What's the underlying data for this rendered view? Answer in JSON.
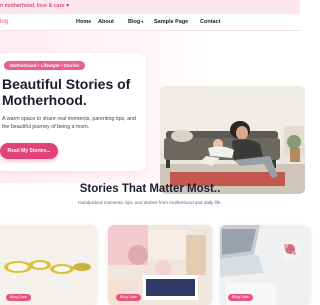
{
  "topbar": {
    "tagline": "n motherhood, love & care",
    "heart": "♥"
  },
  "nav": {
    "logo": "log",
    "items": [
      {
        "label": "Home"
      },
      {
        "label": "About"
      },
      {
        "label": "Blog",
        "caret": "▾"
      },
      {
        "label": "Sample Page"
      },
      {
        "label": "Contact"
      }
    ]
  },
  "hero": {
    "pill": "Motherhood • Lifestyle • Stories",
    "title": "Beautiful Stories of Motherhood.",
    "subtitle": "A warm space to share real moments, parenting tips, and the beautiful journey of being a mom.",
    "cta": "Read My Stories..."
  },
  "section": {
    "title": "Stories That Matter Most..",
    "subtitle": "Handpicked moments, tips, and stories from motherhood and daily life."
  },
  "cards": [
    {
      "badge": "Blog Cate"
    },
    {
      "badge": "Blog Cate"
    },
    {
      "badge": "Blog Cate"
    }
  ],
  "colors": {
    "accent": "#e2427a",
    "pill": "#ec5f8d",
    "topbar": "#fce7ee"
  }
}
